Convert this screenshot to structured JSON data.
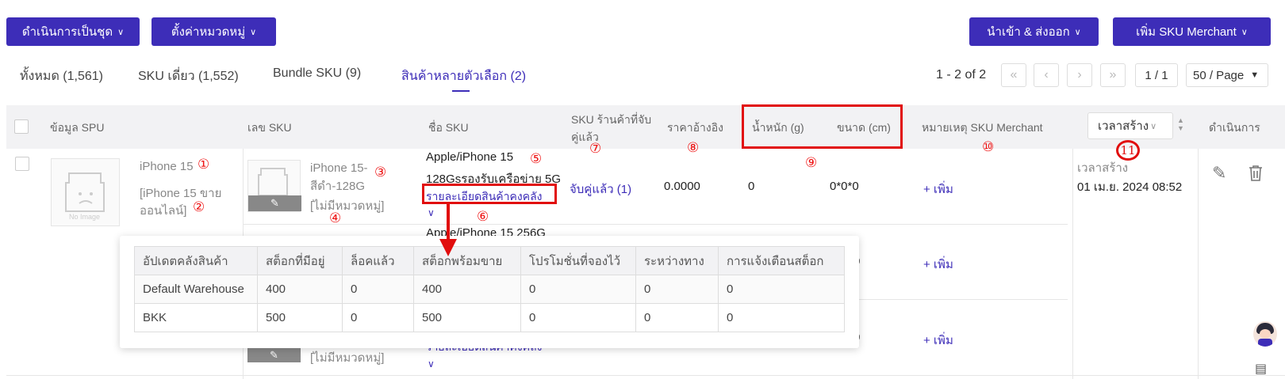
{
  "toolbar": {
    "batch_label": "ดำเนินการเป็นชุด",
    "category_label": "ตั้งค่าหมวดหมู่",
    "import_export_label": "นำเข้า & ส่งออก",
    "add_sku_label": "เพิ่ม SKU Merchant"
  },
  "tabs": [
    {
      "label": "ทั้งหมด (1,561)"
    },
    {
      "label": "SKU เดี่ยว (1,552)"
    },
    {
      "label": "Bundle SKU (9)"
    },
    {
      "label": "สินค้าหลายตัวเลือก (2)"
    }
  ],
  "pager": {
    "count": "1 - 2 of 2",
    "page": "1 / 1",
    "size": "50 / Page"
  },
  "headers": {
    "spu": "ข้อมูล SPU",
    "sku_no": "เลข SKU",
    "sku_name": "ชื่อ SKU",
    "store_sku_1": "SKU ร้านค้าที่จับ",
    "store_sku_2": "คู่แล้ว",
    "ref_price": "ราคาอ้างอิง",
    "weight": "น้ำหนัก (g)",
    "size": "ขนาด (cm)",
    "note": "หมายเหตุ SKU Merchant",
    "created": "เวลาสร้าง",
    "action": "ดำเนินการ"
  },
  "row": {
    "spu_name": "iPhone 15",
    "spu_desc_1": "[iPhone 15 ขาย",
    "spu_desc_2": "ออนไลน์]",
    "img_label": "No Image",
    "sku1_code_1": "iPhone 15-",
    "sku1_code_2": "สีดำ-128G",
    "sku1_category": "[ไม่มีหมวดหมู่]",
    "sku1_name_1": "Apple/iPhone 15",
    "sku1_name_2": "128Gsรองรับเครือข่าย 5G",
    "sku1_detail_link": "รายละเอียดสินค้าคงคลัง",
    "sku1_matched": "จับคู่แล้ว (1)",
    "sku1_price": "0.0000",
    "sku1_weight": "0",
    "sku1_size": "0*0*0",
    "add_note": "+ เพิ่ม",
    "created_label": "เวลาสร้าง",
    "created_time": "01 เม.ย. 2024 08:52",
    "sku2_name_1": "Apple/iPhone 15 256G",
    "sku2_size": "0",
    "sku3_size": "0",
    "sku3_category": "[ไม่มีหมวดหมู่]",
    "sku3_partial": "รายละเอียดสินค้าคงคลัง"
  },
  "markers": [
    "①",
    "②",
    "③",
    "④",
    "⑤",
    "⑥",
    "⑦",
    "⑧",
    "⑨",
    "⑩",
    "11"
  ],
  "popup": {
    "headers": [
      "อัปเดตคลังสินค้า",
      "สต็อกที่มีอยู่",
      "ล็อคแล้ว",
      "สต็อกพร้อมขาย",
      "โปรโมชั่นที่จองไว้",
      "ระหว่างทาง",
      "การแจ้งเตือนสต็อก"
    ],
    "rows": [
      [
        "Default Warehouse",
        "400",
        "0",
        "400",
        "0",
        "0",
        "0"
      ],
      [
        "BKK",
        "500",
        "0",
        "500",
        "0",
        "0",
        "0"
      ]
    ]
  },
  "colors": {
    "accent": "#3d2db8",
    "annotation": "#e10d0d"
  }
}
